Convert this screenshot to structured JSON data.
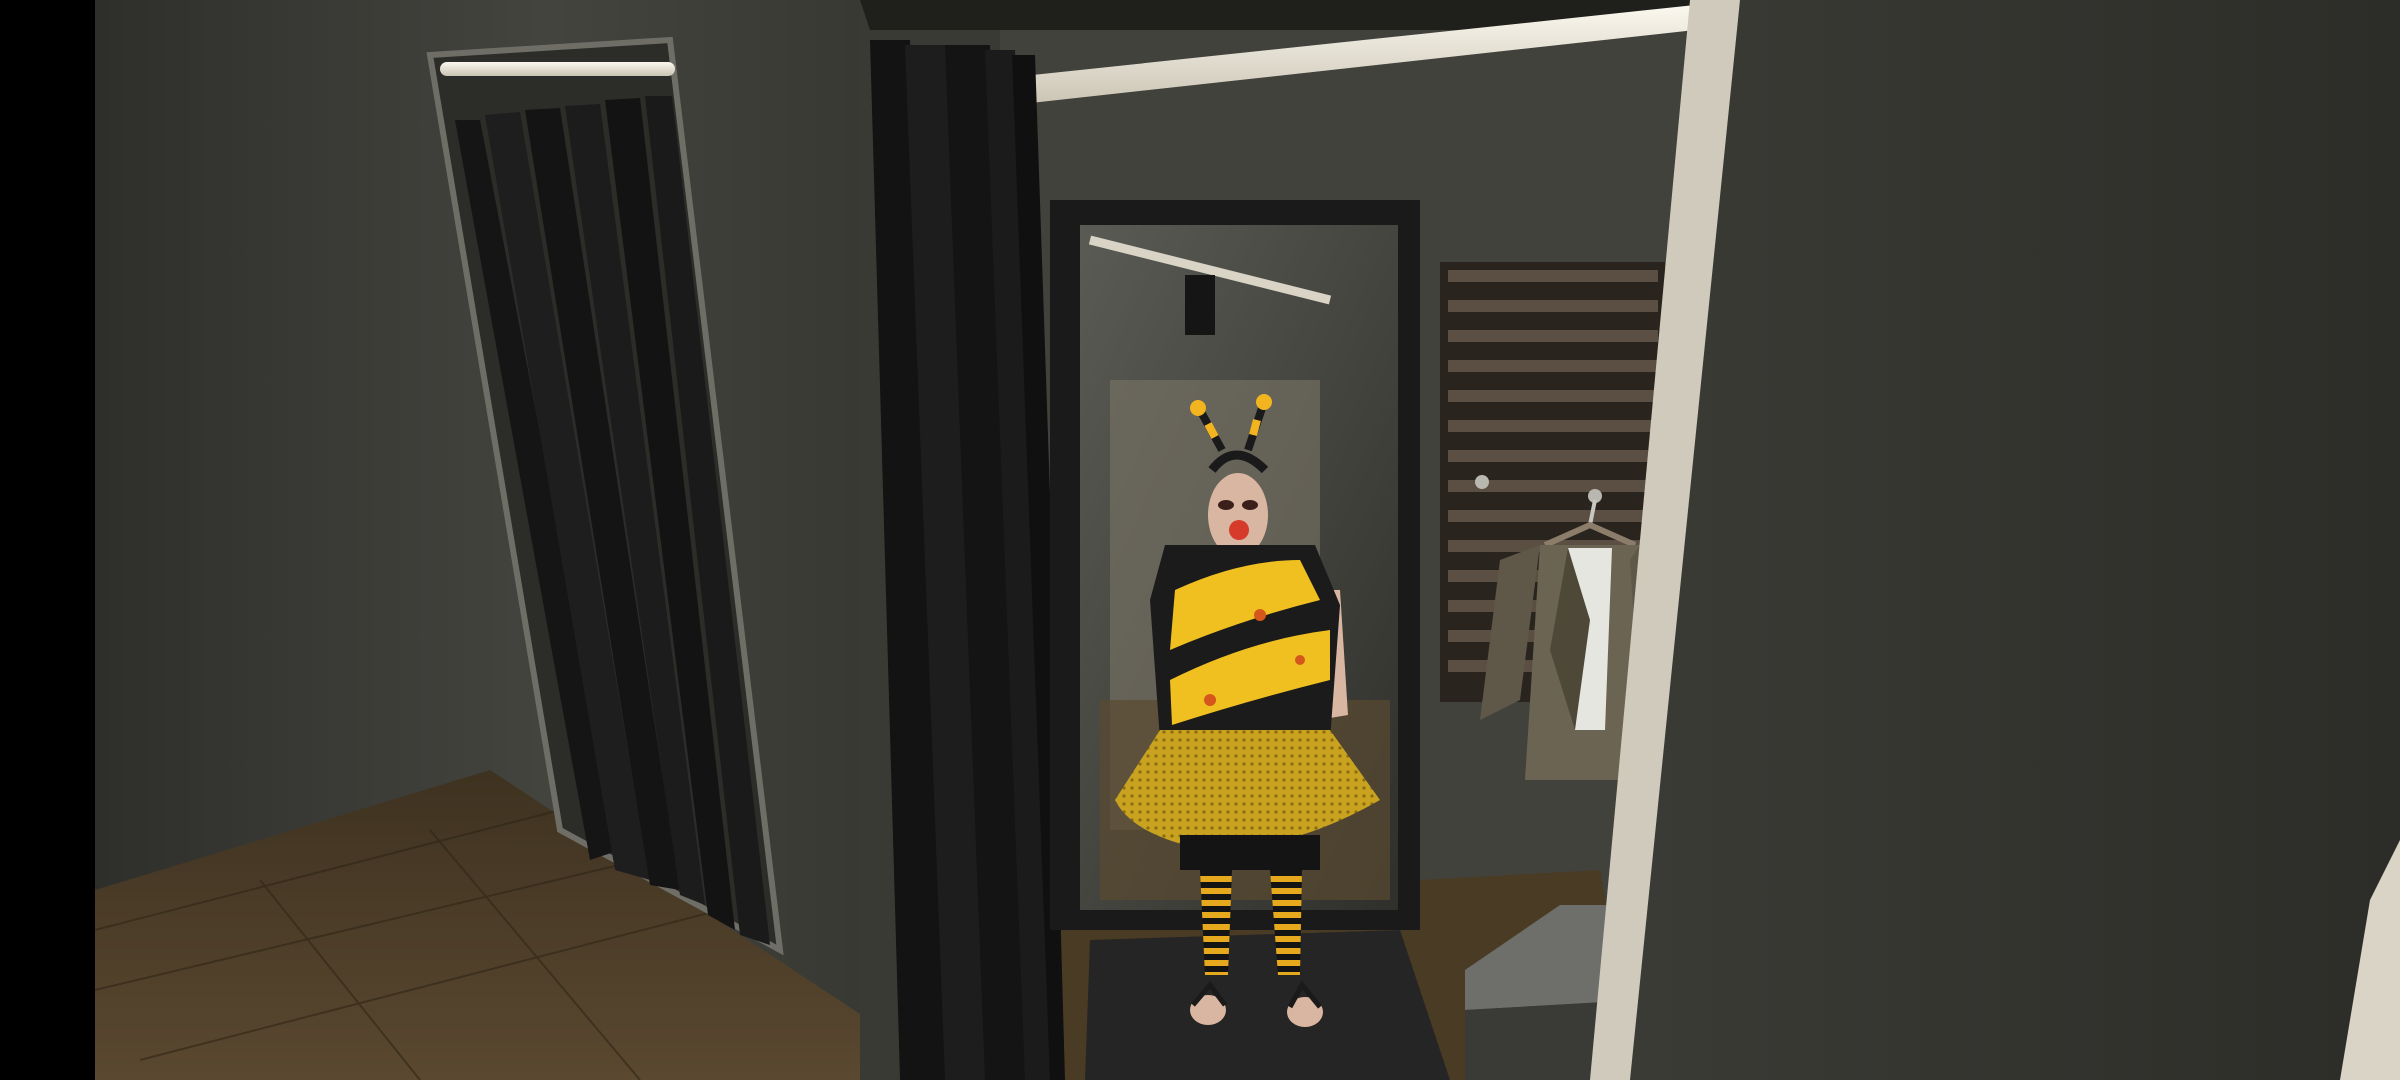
{
  "screen": {
    "type": "game-scene",
    "location": "fitting-room",
    "hud": []
  },
  "scene": {
    "character": {
      "costume": "bee",
      "antennae_color": "#f2b520",
      "shirt_colors": [
        "#f0c020",
        "#1b1b1b"
      ],
      "skirt_color": "#c9a320",
      "leggings_colors": [
        "#e6a81c",
        "#141414"
      ]
    },
    "colors": {
      "letterbox": "#000000",
      "wall": "#3d3d38",
      "wall_dark": "#2a2a27",
      "floor": "#4f3f27",
      "curtain": "#151515",
      "curtain_rod": "#e9e4d6",
      "mirror_frame": "#1a1a1a",
      "rug": "#252525",
      "jacket": "#6b6452",
      "bench": "#6e6e6a"
    }
  }
}
